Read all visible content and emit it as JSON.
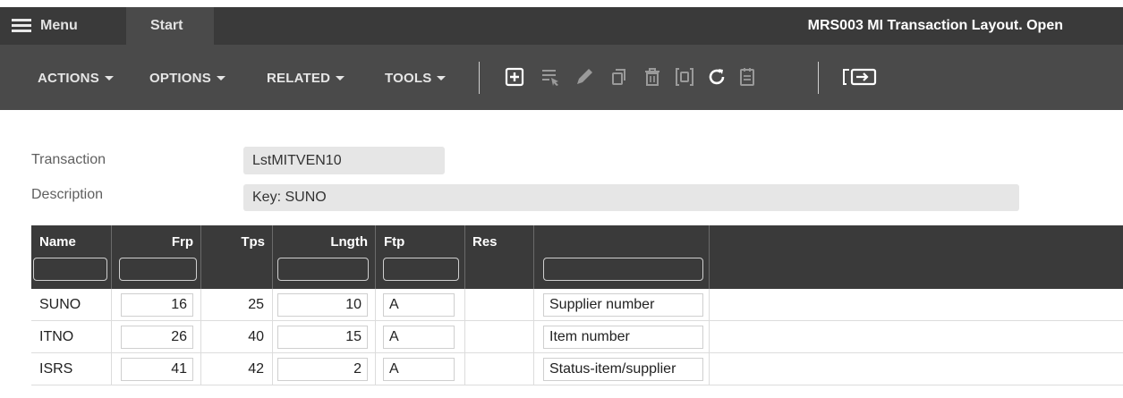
{
  "topbar": {
    "menu_label": "Menu",
    "start_tab": "Start",
    "window_title": "MRS003 MI Transaction Layout. Open"
  },
  "toolbar": {
    "menus": [
      "ACTIONS",
      "OPTIONS",
      "RELATED",
      "TOOLS"
    ],
    "icons": [
      "new-icon",
      "select-icon",
      "edit-icon",
      "copy-icon",
      "delete-icon",
      "display-icon",
      "refresh-icon",
      "notes-icon",
      "close-panel-icon"
    ]
  },
  "form": {
    "transaction_label": "Transaction",
    "transaction_value": "LstMITVEN10",
    "description_label": "Description",
    "description_value": "Key: SUNO"
  },
  "grid": {
    "columns": [
      "Name",
      "Frp",
      "Tps",
      "Lngth",
      "Ftp",
      "Res",
      ""
    ],
    "rows": [
      {
        "name": "SUNO",
        "frp": "16",
        "tps": "25",
        "lngth": "10",
        "ftp": "A",
        "res": "",
        "desc": "Supplier number"
      },
      {
        "name": "ITNO",
        "frp": "26",
        "tps": "40",
        "lngth": "15",
        "ftp": "A",
        "res": "",
        "desc": "Item number"
      },
      {
        "name": "ISRS",
        "frp": "41",
        "tps": "42",
        "lngth": "2",
        "ftp": "A",
        "res": "",
        "desc": "Status-item/supplier"
      }
    ]
  },
  "colors": {
    "topbar": "#3a3a3a",
    "toolbar": "#4a4a4a",
    "field_bg": "#e6e6e6"
  }
}
